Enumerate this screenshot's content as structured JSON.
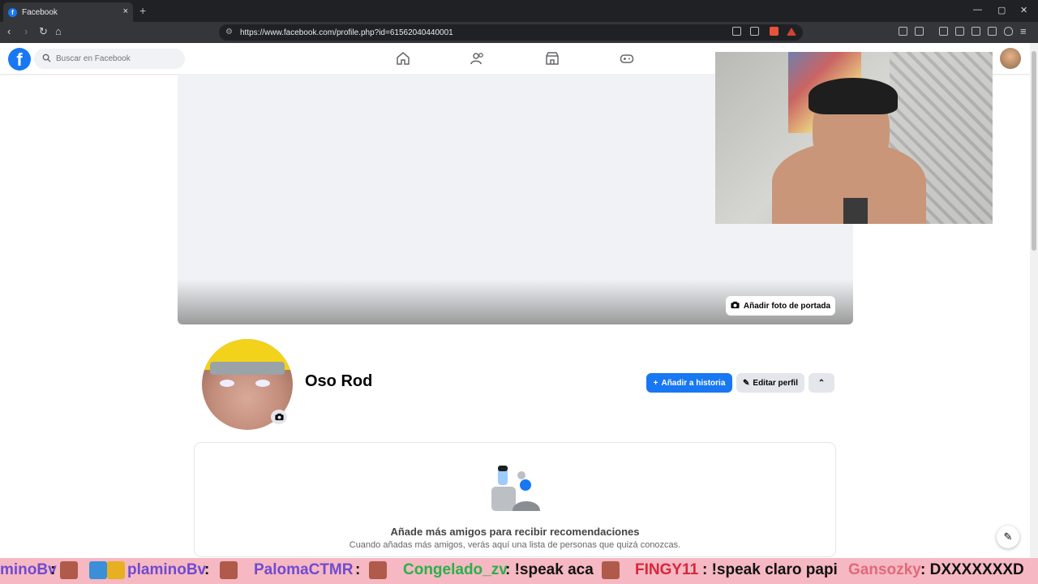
{
  "browser": {
    "tab_title": "Facebook",
    "tab_close": "×",
    "new_tab": "+",
    "url": "https://www.facebook.com/profile.php?id=61562040440001",
    "window_controls": [
      "—",
      "▢",
      "✕"
    ]
  },
  "facebook": {
    "logo_letter": "f",
    "search_placeholder": "Buscar en Facebook",
    "nav_icons": [
      "home-icon",
      "friends-icon",
      "marketplace-icon",
      "gaming-icon"
    ],
    "brand_color": "#1877f2"
  },
  "profile": {
    "name": "Oso Rod",
    "add_cover_photo": "Añadir foto de portada",
    "add_story": "Añadir a historia",
    "edit_profile": "Editar perfil",
    "more_chevron": "⌃"
  },
  "recommendations": {
    "title": "Añade más amigos para recibir recomendaciones",
    "subtitle": "Cuando añadas más amigos, verás aquí una lista de personas que quizá conozcas."
  },
  "chat_overlay": {
    "messages": [
      {
        "user": "minoBv",
        "text": ":",
        "user_color": "#6f4bd1"
      },
      {
        "user": "plaminoBv",
        "text": ":",
        "user_color": "#6f4bd1"
      },
      {
        "user": "PalomaCTMR",
        "text": ":",
        "user_color": "#6f4bd1"
      },
      {
        "user": "Congelado_zv",
        "text": ": !speak aca",
        "user_color": "#27b24a"
      },
      {
        "user": "FINGY11",
        "text": ": !speak claro papi",
        "user_color": "#d9263b"
      },
      {
        "user": "Gansozky",
        "text": ": DXXXXXXXD",
        "user_color": "#e06a7a"
      }
    ]
  }
}
